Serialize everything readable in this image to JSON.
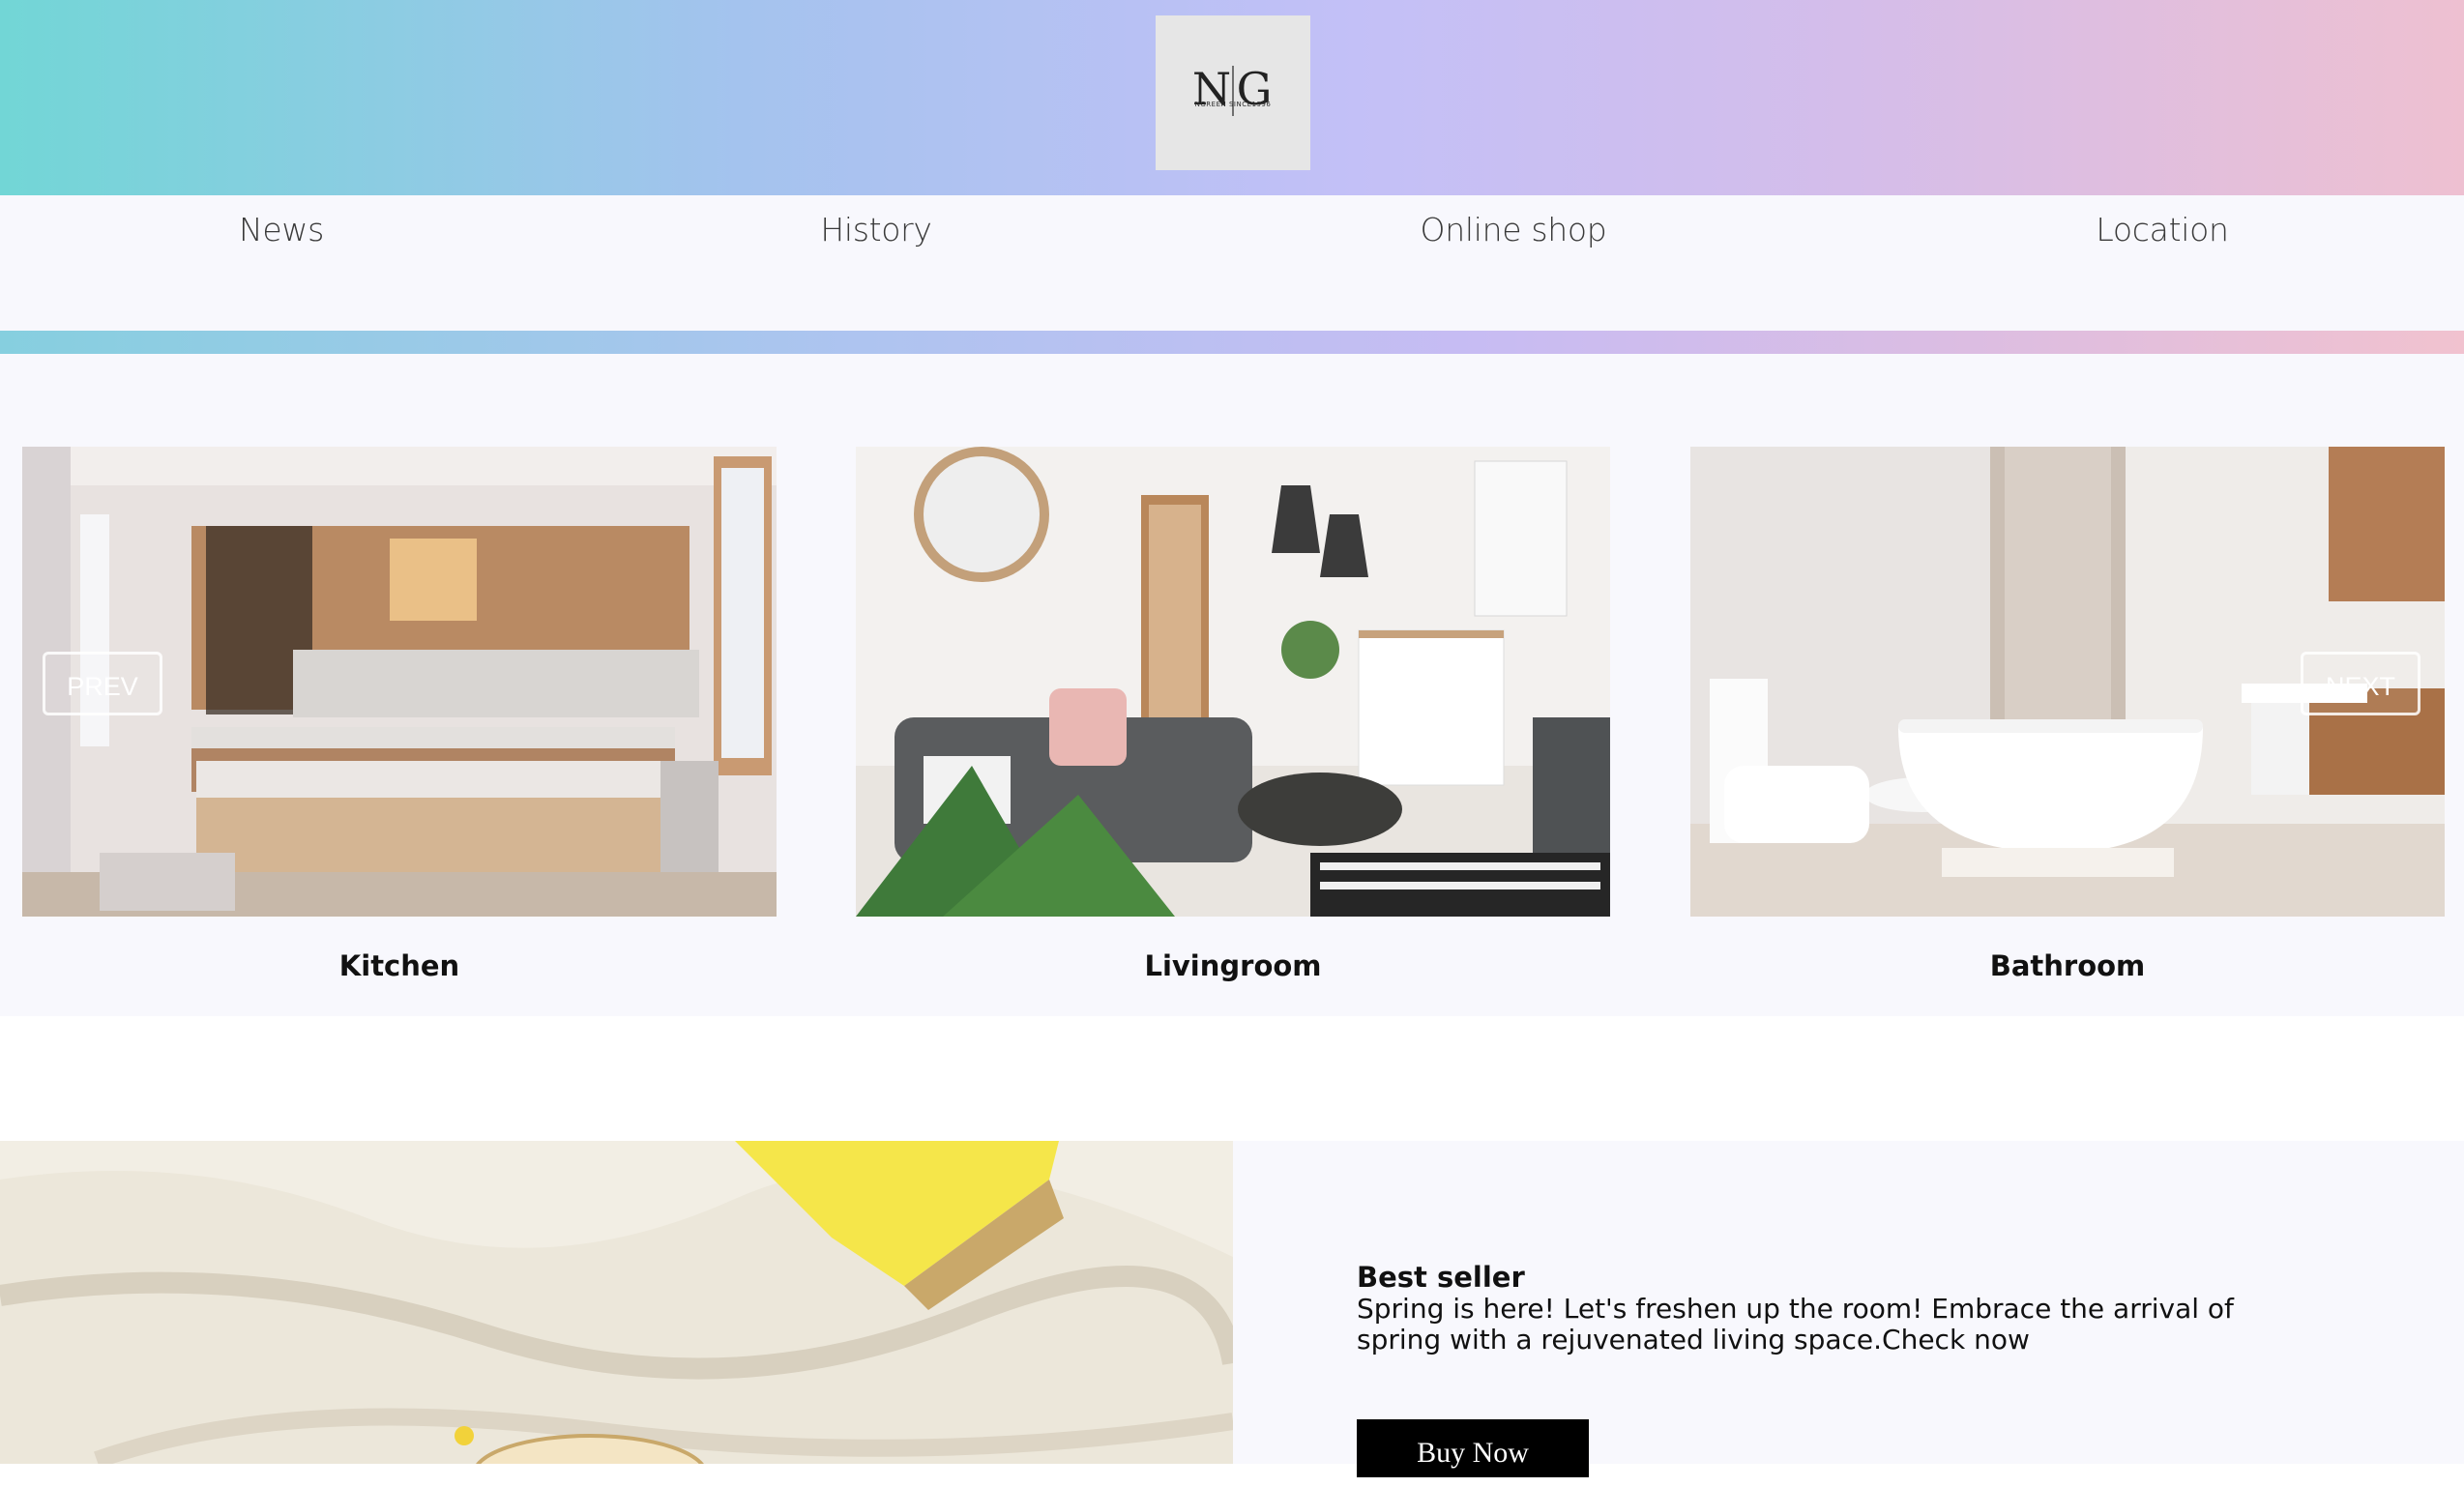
{
  "header": {
    "logo": {
      "monogram_left": "N",
      "monogram_right": "G",
      "caption": "NGREEN SINCE1996"
    }
  },
  "nav": {
    "items": [
      {
        "label": "News"
      },
      {
        "label": "History"
      },
      {
        "label": "Online shop"
      },
      {
        "label": "Location"
      }
    ]
  },
  "carousel": {
    "prev_label": "PREV",
    "next_label": "NEXT",
    "cards": [
      {
        "label": "Kitchen"
      },
      {
        "label": "Livingroom"
      },
      {
        "label": "Bathroom"
      }
    ]
  },
  "promo": {
    "title": "Best seller",
    "text": "Spring is here! Let's freshen up the room! Embrace the arrival of spring with a rejuvenated living space.Check now",
    "button_label": "Buy Now"
  },
  "colors": {
    "header_gradient_start": "#72d6d6",
    "header_gradient_end": "#eec0d1",
    "page_background": "#f8f8fd",
    "button_background": "#000000"
  }
}
